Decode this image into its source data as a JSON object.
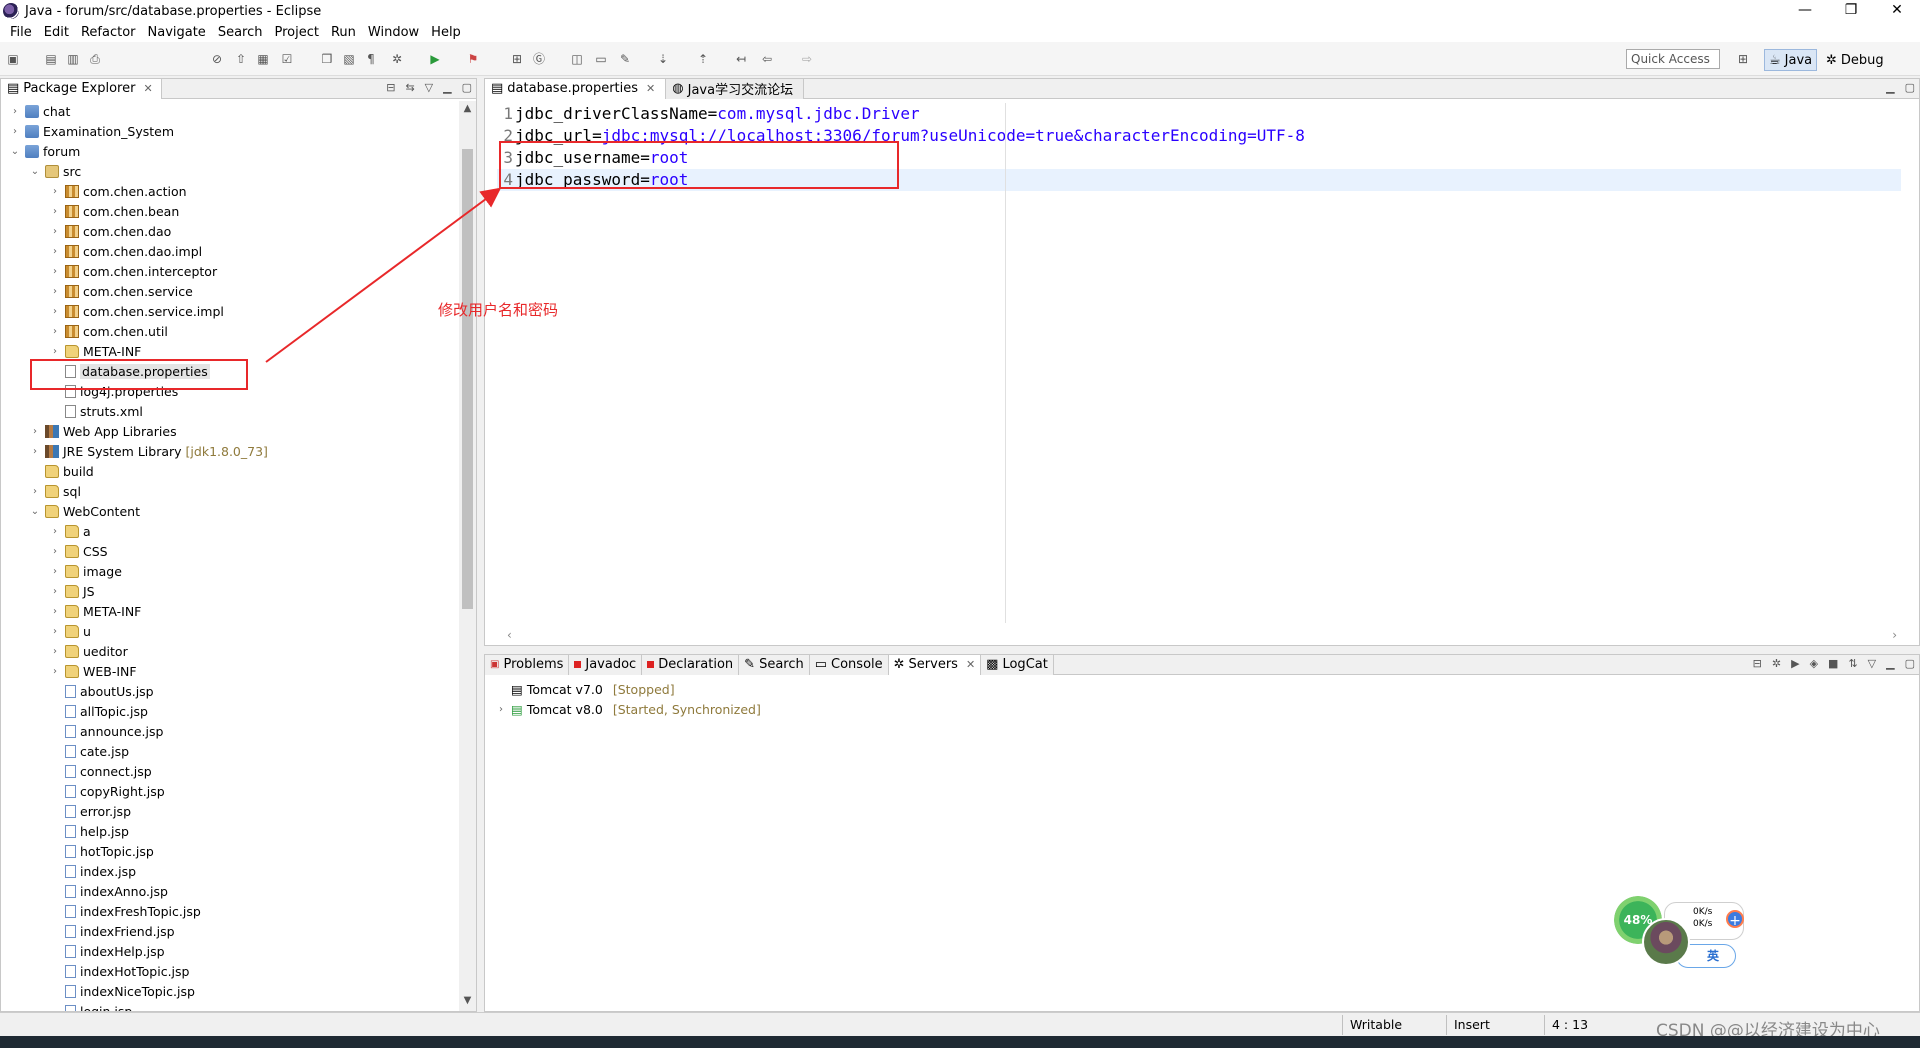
{
  "window": {
    "title": "Java - forum/src/database.properties - Eclipse",
    "controls": [
      "—",
      "❐",
      "✕"
    ]
  },
  "menu": [
    "File",
    "Edit",
    "Refactor",
    "Navigate",
    "Search",
    "Project",
    "Run",
    "Window",
    "Help"
  ],
  "toolbar": {
    "quick_access": "Quick Access"
  },
  "perspectives": {
    "java": "Java",
    "debug": "Debug"
  },
  "package_explorer": {
    "title": "Package Explorer",
    "tree": [
      {
        "label": "chat",
        "icon": "project",
        "twisty": "›",
        "indent": 0
      },
      {
        "label": "Examination_System",
        "icon": "project",
        "twisty": "›",
        "indent": 0
      },
      {
        "label": "forum",
        "icon": "project",
        "twisty": "⌄",
        "indent": 0
      },
      {
        "label": "src",
        "icon": "src-folder",
        "twisty": "⌄",
        "indent": 1
      },
      {
        "label": "com.chen.action",
        "icon": "package",
        "twisty": "›",
        "indent": 2
      },
      {
        "label": "com.chen.bean",
        "icon": "package",
        "twisty": "›",
        "indent": 2
      },
      {
        "label": "com.chen.dao",
        "icon": "package",
        "twisty": "›",
        "indent": 2
      },
      {
        "label": "com.chen.dao.impl",
        "icon": "package",
        "twisty": "›",
        "indent": 2
      },
      {
        "label": "com.chen.interceptor",
        "icon": "package",
        "twisty": "›",
        "indent": 2
      },
      {
        "label": "com.chen.service",
        "icon": "package",
        "twisty": "›",
        "indent": 2
      },
      {
        "label": "com.chen.service.impl",
        "icon": "package",
        "twisty": "›",
        "indent": 2
      },
      {
        "label": "com.chen.util",
        "icon": "package",
        "twisty": "›",
        "indent": 2
      },
      {
        "label": "META-INF",
        "icon": "folder",
        "twisty": "›",
        "indent": 2
      },
      {
        "label": "database.properties",
        "icon": "file",
        "twisty": "",
        "indent": 2,
        "selected": true
      },
      {
        "label": "log4j.properties",
        "icon": "file",
        "twisty": "",
        "indent": 2
      },
      {
        "label": "struts.xml",
        "icon": "file",
        "twisty": "",
        "indent": 2
      },
      {
        "label": "Web App Libraries",
        "icon": "library",
        "twisty": "›",
        "indent": 1
      },
      {
        "label": "JRE System Library",
        "extra": "[jdk1.8.0_73]",
        "icon": "library",
        "twisty": "›",
        "indent": 1
      },
      {
        "label": "build",
        "icon": "folder",
        "twisty": "",
        "indent": 1
      },
      {
        "label": "sql",
        "icon": "folder",
        "twisty": "›",
        "indent": 1
      },
      {
        "label": "WebContent",
        "icon": "folder",
        "twisty": "⌄",
        "indent": 1
      },
      {
        "label": "a",
        "icon": "folder",
        "twisty": "›",
        "indent": 2
      },
      {
        "label": "CSS",
        "icon": "folder",
        "twisty": "›",
        "indent": 2
      },
      {
        "label": "image",
        "icon": "folder",
        "twisty": "›",
        "indent": 2
      },
      {
        "label": "JS",
        "icon": "folder",
        "twisty": "›",
        "indent": 2
      },
      {
        "label": "META-INF",
        "icon": "folder",
        "twisty": "›",
        "indent": 2
      },
      {
        "label": "u",
        "icon": "folder",
        "twisty": "›",
        "indent": 2
      },
      {
        "label": "ueditor",
        "icon": "folder",
        "twisty": "›",
        "indent": 2
      },
      {
        "label": "WEB-INF",
        "icon": "folder",
        "twisty": "›",
        "indent": 2
      },
      {
        "label": "aboutUs.jsp",
        "icon": "jsp",
        "twisty": "",
        "indent": 2
      },
      {
        "label": "allTopic.jsp",
        "icon": "jsp",
        "twisty": "",
        "indent": 2
      },
      {
        "label": "announce.jsp",
        "icon": "jsp",
        "twisty": "",
        "indent": 2
      },
      {
        "label": "cate.jsp",
        "icon": "jsp",
        "twisty": "",
        "indent": 2
      },
      {
        "label": "connect.jsp",
        "icon": "jsp",
        "twisty": "",
        "indent": 2
      },
      {
        "label": "copyRight.jsp",
        "icon": "jsp",
        "twisty": "",
        "indent": 2
      },
      {
        "label": "error.jsp",
        "icon": "jsp",
        "twisty": "",
        "indent": 2
      },
      {
        "label": "help.jsp",
        "icon": "jsp",
        "twisty": "",
        "indent": 2
      },
      {
        "label": "hotTopic.jsp",
        "icon": "jsp",
        "twisty": "",
        "indent": 2
      },
      {
        "label": "index.jsp",
        "icon": "jsp",
        "twisty": "",
        "indent": 2
      },
      {
        "label": "indexAnno.jsp",
        "icon": "jsp",
        "twisty": "",
        "indent": 2
      },
      {
        "label": "indexFreshTopic.jsp",
        "icon": "jsp",
        "twisty": "",
        "indent": 2
      },
      {
        "label": "indexFriend.jsp",
        "icon": "jsp",
        "twisty": "",
        "indent": 2
      },
      {
        "label": "indexHelp.jsp",
        "icon": "jsp",
        "twisty": "",
        "indent": 2
      },
      {
        "label": "indexHotTopic.jsp",
        "icon": "jsp",
        "twisty": "",
        "indent": 2
      },
      {
        "label": "indexNiceTopic.jsp",
        "icon": "jsp",
        "twisty": "",
        "indent": 2
      },
      {
        "label": "login.jsp",
        "icon": "jsp",
        "twisty": "",
        "indent": 2
      }
    ]
  },
  "editor": {
    "tabs": [
      {
        "label": "database.properties",
        "active": true
      },
      {
        "label": "Java学习交流论坛",
        "active": false
      }
    ],
    "lines": [
      {
        "num": "1",
        "key": "jdbc_driverClassName=",
        "value": "com.mysql.jdbc.Driver"
      },
      {
        "num": "2",
        "key": "jdbc_url=",
        "value": "jdbc:mysql://localhost:3306/forum?useUnicode=true&characterEncoding=UTF-8"
      },
      {
        "num": "3",
        "key": "jdbc_username=",
        "value": "root"
      },
      {
        "num": "4",
        "key": "jdbc_password=",
        "value": "root"
      }
    ]
  },
  "annotation": {
    "text": "修改用户名和密码",
    "color": "#e8282a"
  },
  "bottom_panel": {
    "tabs": [
      {
        "label": "Problems",
        "active": false
      },
      {
        "label": "Javadoc",
        "active": false
      },
      {
        "label": "Declaration",
        "active": false
      },
      {
        "label": "Search",
        "active": false
      },
      {
        "label": "Console",
        "active": false
      },
      {
        "label": "Servers",
        "active": true
      },
      {
        "label": "LogCat",
        "active": false
      }
    ],
    "servers": [
      {
        "name": "Tomcat v7.0",
        "status": "[Stopped]",
        "expandable": false
      },
      {
        "name": "Tomcat v8.0",
        "status": "[Started, Synchronized]",
        "expandable": true
      }
    ]
  },
  "status_bar": {
    "mode": "Writable",
    "insert": "Insert",
    "position": "4 : 13"
  },
  "watermark": "CSDN @@以经济建设为中心",
  "widget": {
    "percent": "48%",
    "up": "0K/s",
    "down": "0K/s",
    "ime": "英"
  }
}
